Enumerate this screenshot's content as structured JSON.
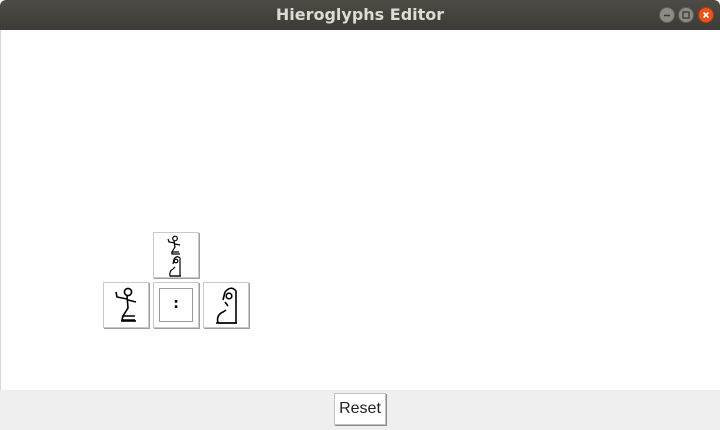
{
  "window": {
    "title": "Hieroglyphs Editor",
    "controls": [
      "minimize-icon",
      "maximize-icon",
      "close-icon"
    ],
    "close_color": "#e9541f"
  },
  "canvas": {
    "tiles": [
      {
        "name": "glyph-tile-stacked",
        "icon": "seated-man-over-seated-woman-icon"
      },
      {
        "name": "glyph-tile-seated-man",
        "icon": "seated-man-raised-arm-icon"
      },
      {
        "name": "glyph-tile-colon-group",
        "icon": "group-box-icon",
        "text": ":"
      },
      {
        "name": "glyph-tile-seated-woman",
        "icon": "seated-woman-icon"
      }
    ]
  },
  "footer": {
    "reset_label": "Reset"
  }
}
